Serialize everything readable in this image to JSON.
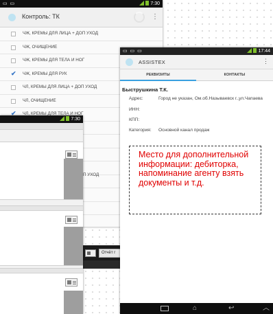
{
  "list_screen": {
    "status_time": "7:30",
    "title": "Контроль: ТК",
    "items": [
      {
        "label": "ЧЖ, КРЕМЫ ДЛЯ ЛИЦА + ДОП УХОД",
        "checked": false
      },
      {
        "label": "ЧЖ, ОЧИЩЕНИЕ",
        "checked": false
      },
      {
        "label": "ЧЖ, КРЕМЫ ДЛЯ ТЕЛА И НОГ",
        "checked": false
      },
      {
        "label": "ЧЖ, КРЕМЫ ДЛЯ РУК",
        "checked": true
      },
      {
        "label": "ЧЛ, КРЕМЫ ДЛЯ ЛИЦА + ДОП УХОД",
        "checked": false
      },
      {
        "label": "ЧЛ, ОЧИЩЕНИЕ",
        "checked": false
      },
      {
        "label": "ЧЛ, КРЕМЫ ДЛЯ ТЕЛА И НОГ",
        "checked": true
      }
    ],
    "partial_item_label": "П УХОД",
    "report_button": "Отчёт г"
  },
  "second_screen": {
    "status_time": "7:30"
  },
  "client_screen": {
    "status_time": "17:44",
    "title": "ASSISTEX",
    "tabs": [
      {
        "label": "РЕКВИЗИТЫ",
        "active": true
      },
      {
        "label": "КОНТАКТЫ",
        "active": false
      }
    ],
    "client_name": "Быструшкина Т.К.",
    "fields": [
      {
        "label": "Адрес:",
        "value": "Город не указан, Ом.об.Называевск г.,ул.Чапаева"
      },
      {
        "label": "ИНН:",
        "value": ""
      },
      {
        "label": "КПП:",
        "value": ""
      },
      {
        "label": "Категория:",
        "value": "Основной канал продаж"
      }
    ],
    "note": "Место для дополнительной информации: дебиторка, напоминание агенту взять документы и т.д."
  },
  "colors": {
    "note_text": "#e00000",
    "checkbox_checked": "#3a78c7",
    "tab_indicator": "#3aa0e0",
    "battery": "#7fbf2a"
  },
  "icons": {
    "nav_back": "back-icon",
    "nav_home": "home-icon",
    "nav_recent": "recent-apps-icon",
    "overflow_menu": "overflow-menu-icon",
    "document": "document-icon"
  }
}
